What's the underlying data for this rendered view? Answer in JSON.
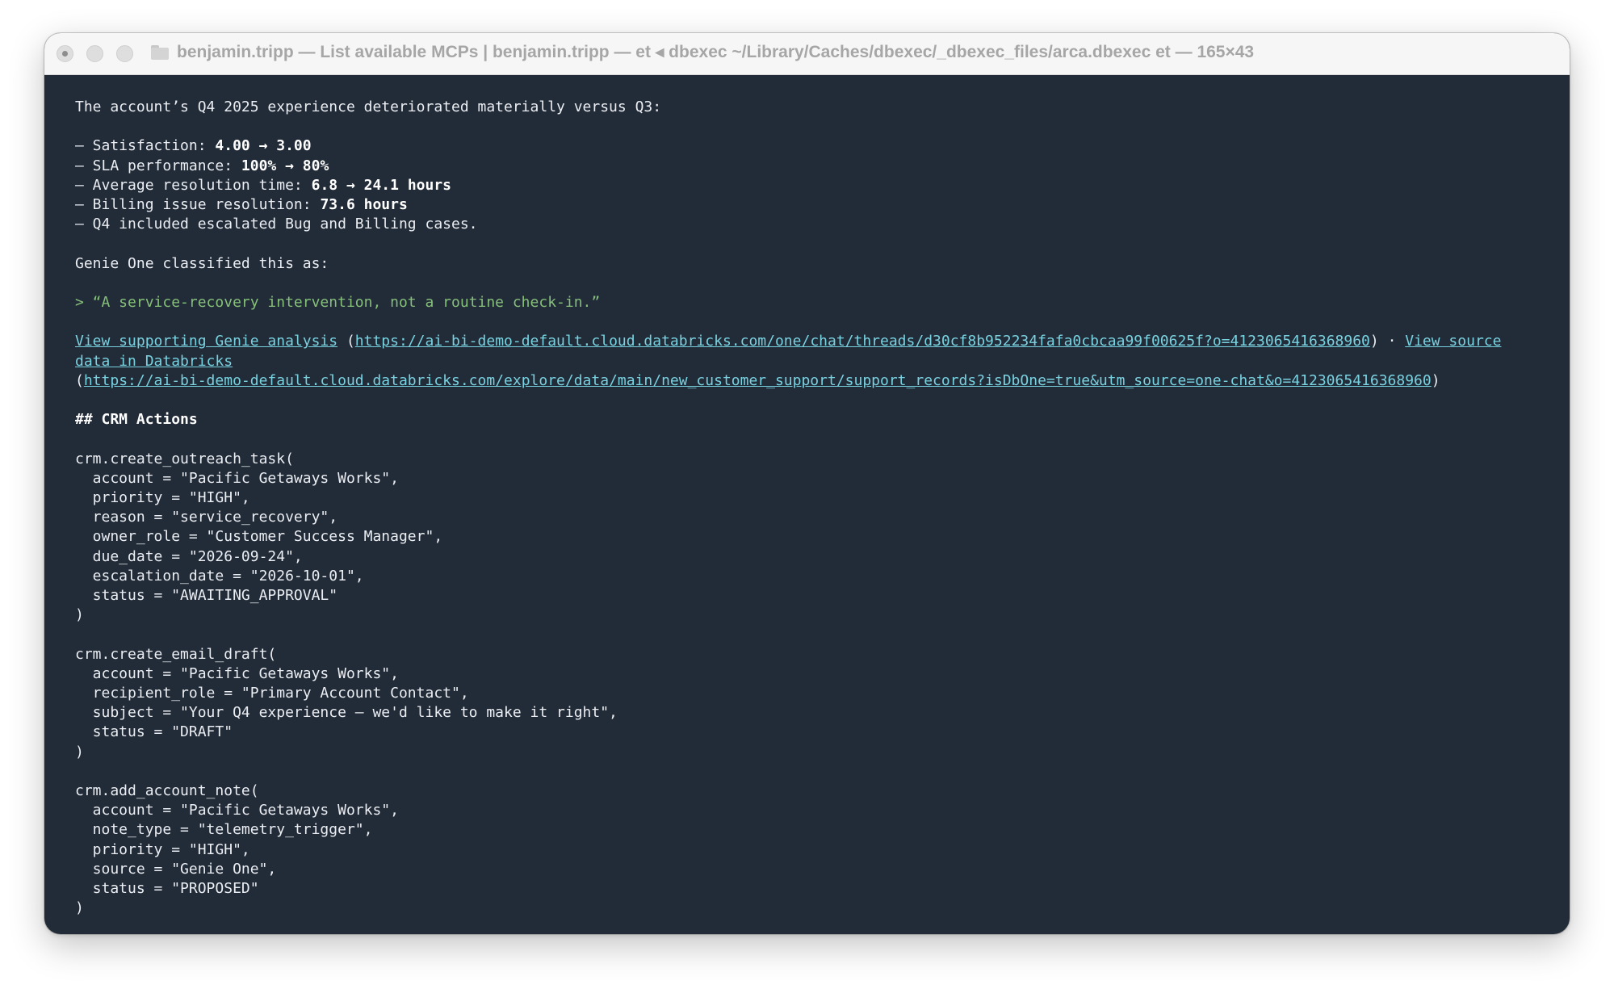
{
  "window": {
    "title": "benjamin.tripp — List available MCPs | benjamin.tripp — et ◂ dbexec ~/Library/Caches/dbexec/_dbexec_files/arca.dbexec et — 165×43"
  },
  "summary": {
    "intro": "The account’s Q4 2025 experience deteriorated materially versus Q3:",
    "bullets": [
      {
        "label": "– Satisfaction: ",
        "value": "4.00 → 3.00"
      },
      {
        "label": "– SLA performance: ",
        "value": "100% → 80%"
      },
      {
        "label": "– Average resolution time: ",
        "value": "6.8 → 24.1 hours"
      },
      {
        "label": "– Billing issue resolution: ",
        "value": "73.6 hours"
      },
      {
        "label": "– Q4 included escalated Bug and Billing cases.",
        "value": ""
      }
    ],
    "classified": "Genie One classified this as:",
    "quote": "> “A service-recovery intervention, not a routine check-in.”"
  },
  "links": {
    "analysis_text": "View supporting Genie analysis",
    "analysis_url": "https://ai-bi-demo-default.cloud.databricks.com/one/chat/threads/d30cf8b952234fafa0cbcaa99f00625f?o=4123065416368960",
    "separator": ") · ",
    "source_text_1": "View source",
    "source_text_2": "data in Databricks",
    "source_url": "https://ai-bi-demo-default.cloud.databricks.com/explore/data/main/new_customer_support/support_records?isDbOne=true&utm_source=one-chat&o=4123065416368960"
  },
  "crm": {
    "heading": "## CRM Actions",
    "blocks": [
      {
        "call": "crm.create_outreach_task(",
        "args": [
          "  account = \"Pacific Getaways Works\",",
          "  priority = \"HIGH\",",
          "  reason = \"service_recovery\",",
          "  owner_role = \"Customer Success Manager\",",
          "  due_date = \"2026-09-24\",",
          "  escalation_date = \"2026-10-01\",",
          "  status = \"AWAITING_APPROVAL\""
        ],
        "close": ")"
      },
      {
        "call": "crm.create_email_draft(",
        "args": [
          "  account = \"Pacific Getaways Works\",",
          "  recipient_role = \"Primary Account Contact\",",
          "  subject = \"Your Q4 experience — we'd like to make it right\",",
          "  status = \"DRAFT\""
        ],
        "close": ")"
      },
      {
        "call": "crm.add_account_note(",
        "args": [
          "  account = \"Pacific Getaways Works\",",
          "  note_type = \"telemetry_trigger\",",
          "  priority = \"HIGH\",",
          "  source = \"Genie One\",",
          "  status = \"PROPOSED\""
        ],
        "close": ")"
      }
    ]
  }
}
